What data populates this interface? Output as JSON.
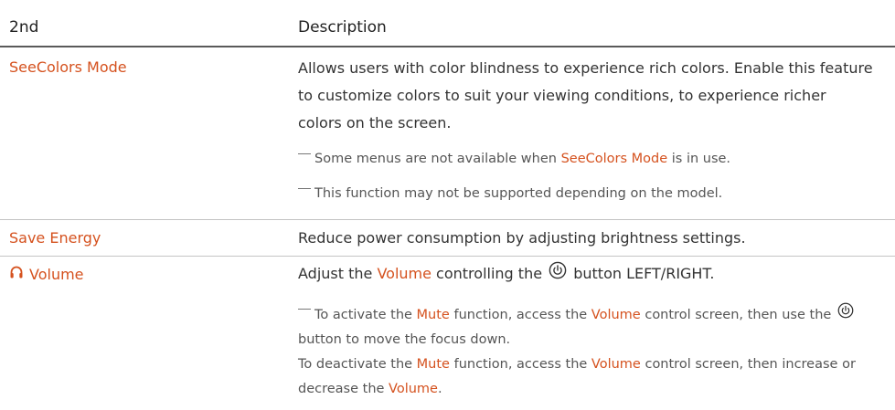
{
  "headers": {
    "col1": "2nd",
    "col2": "Description"
  },
  "rows": {
    "seecolors": {
      "name": "SeeColors Mode",
      "description": "Allows users with color blindness to experience rich colors. Enable this feature to customize colors to suit your viewing conditions, to experience richer colors on the screen.",
      "note1": {
        "before": "Some menus are not available when ",
        "hl": "SeeColors Mode",
        "after": " is in use."
      },
      "note2": "This function may not be supported depending on the model."
    },
    "save_energy": {
      "name": "Save Energy",
      "description": "Reduce power consumption by adjusting brightness settings."
    },
    "volume": {
      "name": "Volume",
      "icon": "headphones-icon",
      "desc": {
        "p1": "Adjust the ",
        "hl": "Volume",
        "p2": " controlling the ",
        "p3": " button LEFT/RIGHT."
      },
      "note": {
        "a": "To activate the ",
        "a_mute": "Mute",
        "b": " function, access the ",
        "b_volume": "Volume",
        "c": " control screen, then use the ",
        "d": " button to move the focus down.",
        "e": "To deactivate the ",
        "e_mute": "Mute",
        "f": " function, access the ",
        "f_volume": "Volume",
        "g": " control screen, then increase or decrease the ",
        "g_volume": "Volume",
        "h": "."
      }
    }
  },
  "colors": {
    "accent": "#d5521f",
    "text": "#333333",
    "rule": "#c4c4c4"
  }
}
